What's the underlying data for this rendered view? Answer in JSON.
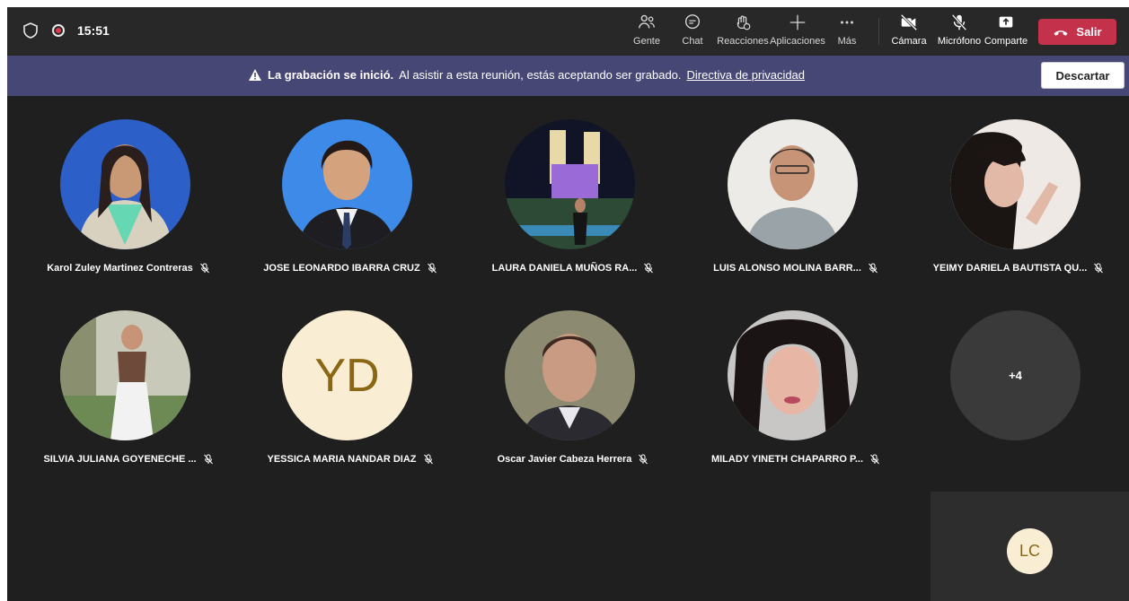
{
  "topbar": {
    "time": "15:51",
    "buttons": {
      "people": "Gente",
      "chat": "Chat",
      "reactions": "Reacciones",
      "apps": "Aplicaciones",
      "more": "Más",
      "camera": "Cámara",
      "microphone": "Micrófono",
      "share": "Comparte",
      "leave": "Salir"
    }
  },
  "banner": {
    "title": "La grabación se inició.",
    "message": "Al asistir a esta reunión, estás aceptando ser grabado.",
    "link": "Directiva de privacidad",
    "dismiss": "Descartar"
  },
  "participants": [
    {
      "name": "Karol Zuley Martinez Contreras",
      "muted": true
    },
    {
      "name": "JOSE LEONARDO IBARRA CRUZ",
      "muted": true
    },
    {
      "name": "LAURA DANIELA MUÑOS RA...",
      "muted": true
    },
    {
      "name": "LUIS ALONSO MOLINA BARR...",
      "muted": true
    },
    {
      "name": "YEIMY DARIELA BAUTISTA QU...",
      "muted": true
    },
    {
      "name": "SILVIA JULIANA GOYENECHE ...",
      "muted": true
    },
    {
      "name": "YESSICA MARIA NANDAR DIAZ",
      "initials": "YD",
      "muted": true
    },
    {
      "name": "Oscar Javier Cabeza Herrera",
      "muted": true
    },
    {
      "name": "MILADY YINETH CHAPARRO P...",
      "muted": true
    }
  ],
  "overflow_count": "+4",
  "self_initials": "LC",
  "colors": {
    "stage": "#201f1f",
    "topbar": "#292828",
    "banner": "#464775",
    "leave": "#c4314b",
    "initials_bg": "#f9eed4",
    "initials_fg": "#8b6714"
  }
}
